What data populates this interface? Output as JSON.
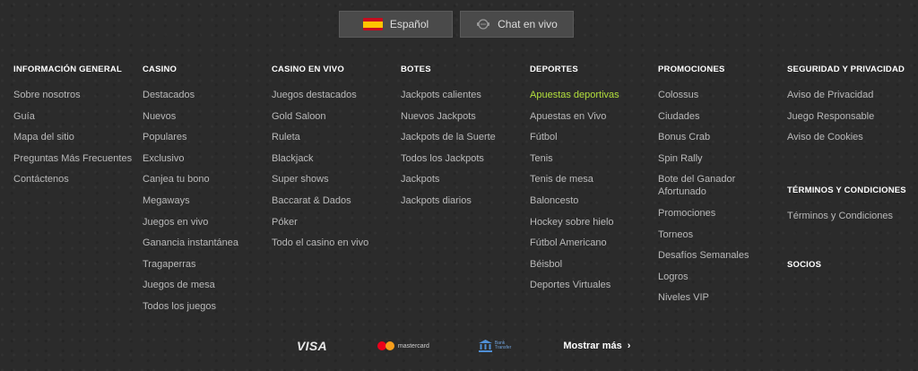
{
  "topbar": {
    "language_label": "Español",
    "chat_label": "Chat en vivo",
    "flag_icon": "spain-flag-icon",
    "chat_icon": "chat-support-icon"
  },
  "columns": [
    {
      "title": "INFORMACIÓN GENERAL",
      "items": [
        "Sobre nosotros",
        "Guía",
        "Mapa del sitio",
        "Preguntas Más Frecuentes",
        "Contáctenos"
      ]
    },
    {
      "title": "CASINO",
      "items": [
        "Destacados",
        "Nuevos",
        "Populares",
        "Exclusivo",
        "Canjea tu bono",
        "Megaways",
        "Juegos en vivo",
        "Ganancia instantánea",
        "Tragaperras",
        "Juegos de mesa",
        "Todos los juegos"
      ]
    },
    {
      "title": "CASINO EN VIVO",
      "items": [
        "Juegos destacados",
        "Gold Saloon",
        "Ruleta",
        "Blackjack",
        "Super shows",
        "Baccarat & Dados",
        "Póker",
        "Todo el casino en vivo"
      ]
    },
    {
      "title": "BOTES",
      "items": [
        "Jackpots calientes",
        "Nuevos Jackpots",
        "Jackpots de la Suerte",
        "Todos los Jackpots",
        "Jackpots",
        "Jackpots diarios"
      ]
    },
    {
      "title": "DEPORTES",
      "items": [
        "Apuestas deportivas",
        "Apuestas en Vivo",
        "Fútbol",
        "Tenis",
        "Tenis de mesa",
        "Baloncesto",
        "Hockey sobre hielo",
        "Fútbol Americano",
        "Béisbol",
        "Deportes Virtuales"
      ]
    },
    {
      "title": "PROMOCIONES",
      "items": [
        "Colossus",
        "Ciudades",
        "Bonus Crab",
        "Spin Rally",
        "Bote del Ganador Afortunado",
        "Promociones",
        "Torneos",
        "Desafíos Semanales",
        "Logros",
        "Niveles VIP"
      ]
    },
    {
      "title": "SEGURIDAD Y PRIVACIDAD",
      "items": [
        "Aviso de Privacidad",
        "Juego Responsable",
        "Aviso de Cookies"
      ]
    }
  ],
  "terms": {
    "title": "TÉRMINOS Y CONDICIONES",
    "items": [
      "Términos y Condiciones"
    ]
  },
  "partners": {
    "title": "SOCIOS"
  },
  "active_color": "#b3e03c",
  "payments": {
    "visa": "VISA",
    "mastercard": "mastercard",
    "bank_line1": "Bank",
    "bank_line2": "Transfer",
    "more_label": "Mostrar más"
  }
}
